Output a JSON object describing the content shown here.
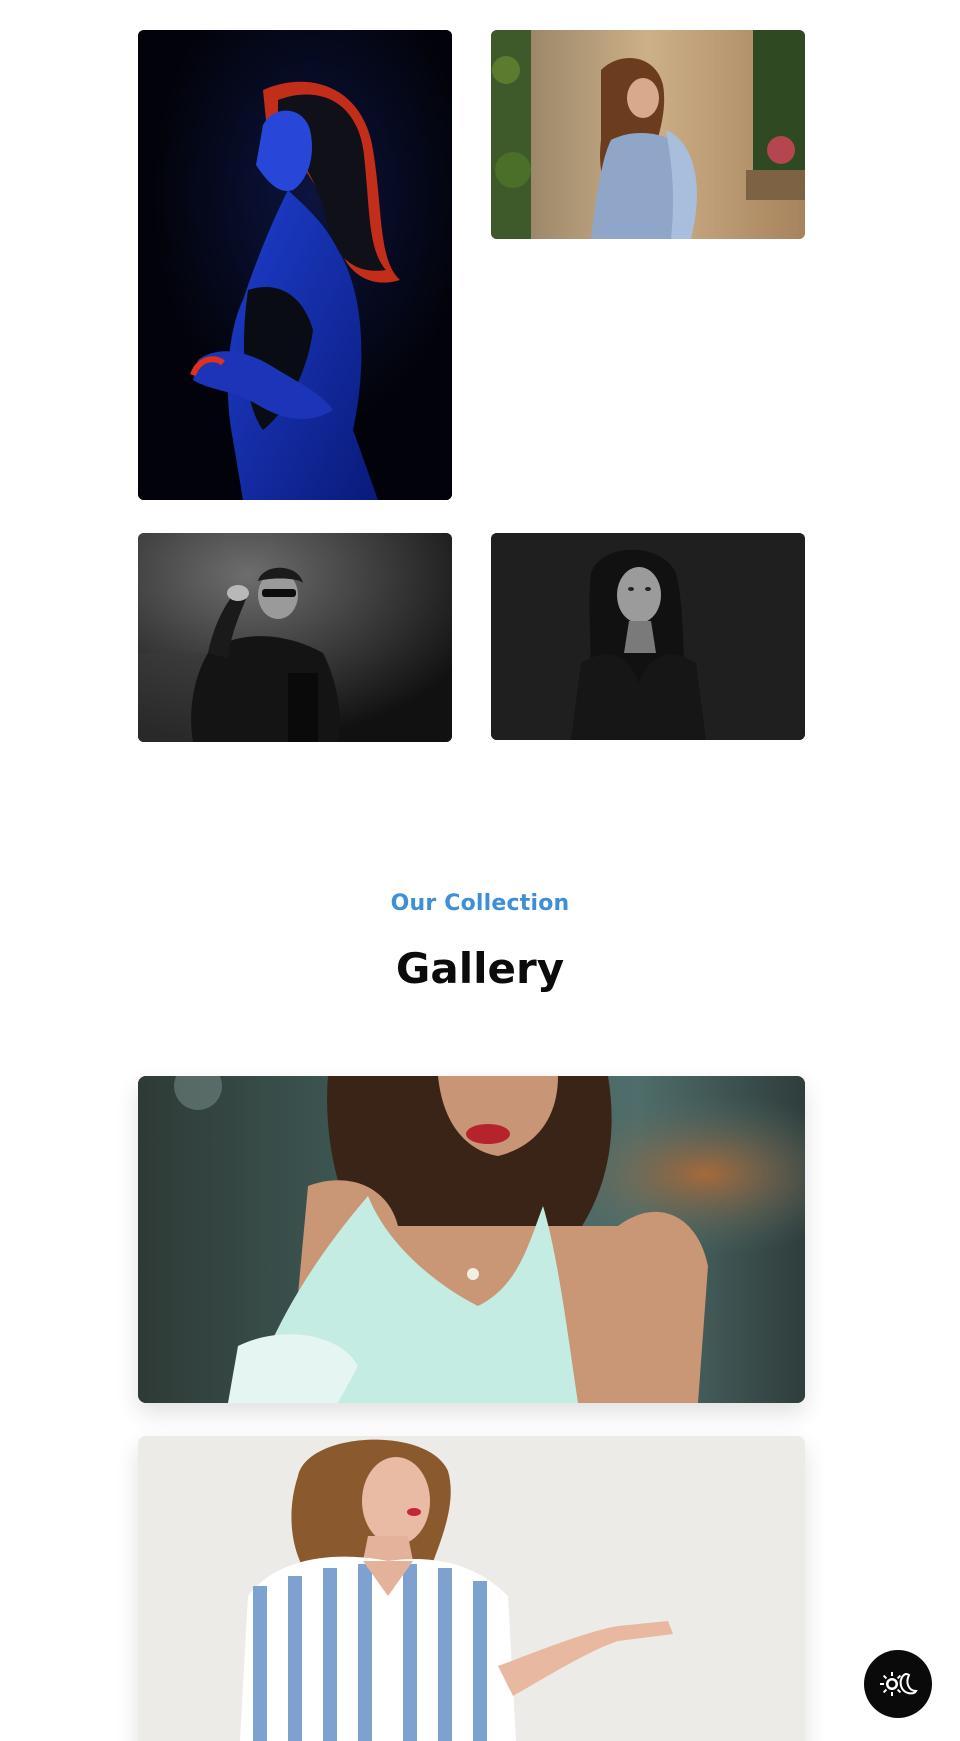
{
  "gallery_section": {
    "eyebrow": "Our Collection",
    "title": "Gallery"
  },
  "top_grid": {
    "photos": [
      {
        "subject": "woman-neon-portrait"
      },
      {
        "subject": "woman-blue-saree"
      },
      {
        "subject": "man-black-white"
      },
      {
        "subject": "woman-dark-portrait"
      }
    ]
  },
  "gallery": {
    "items": [
      {
        "subject": "woman-mint-top"
      },
      {
        "subject": "woman-striped-shirt"
      }
    ]
  },
  "theme_toggle": {
    "icon": "sun-moon-icon"
  },
  "colors": {
    "accent": "#3d8fd6",
    "heading": "#0b0b0b",
    "toggle_bg": "#0a0a0a"
  }
}
